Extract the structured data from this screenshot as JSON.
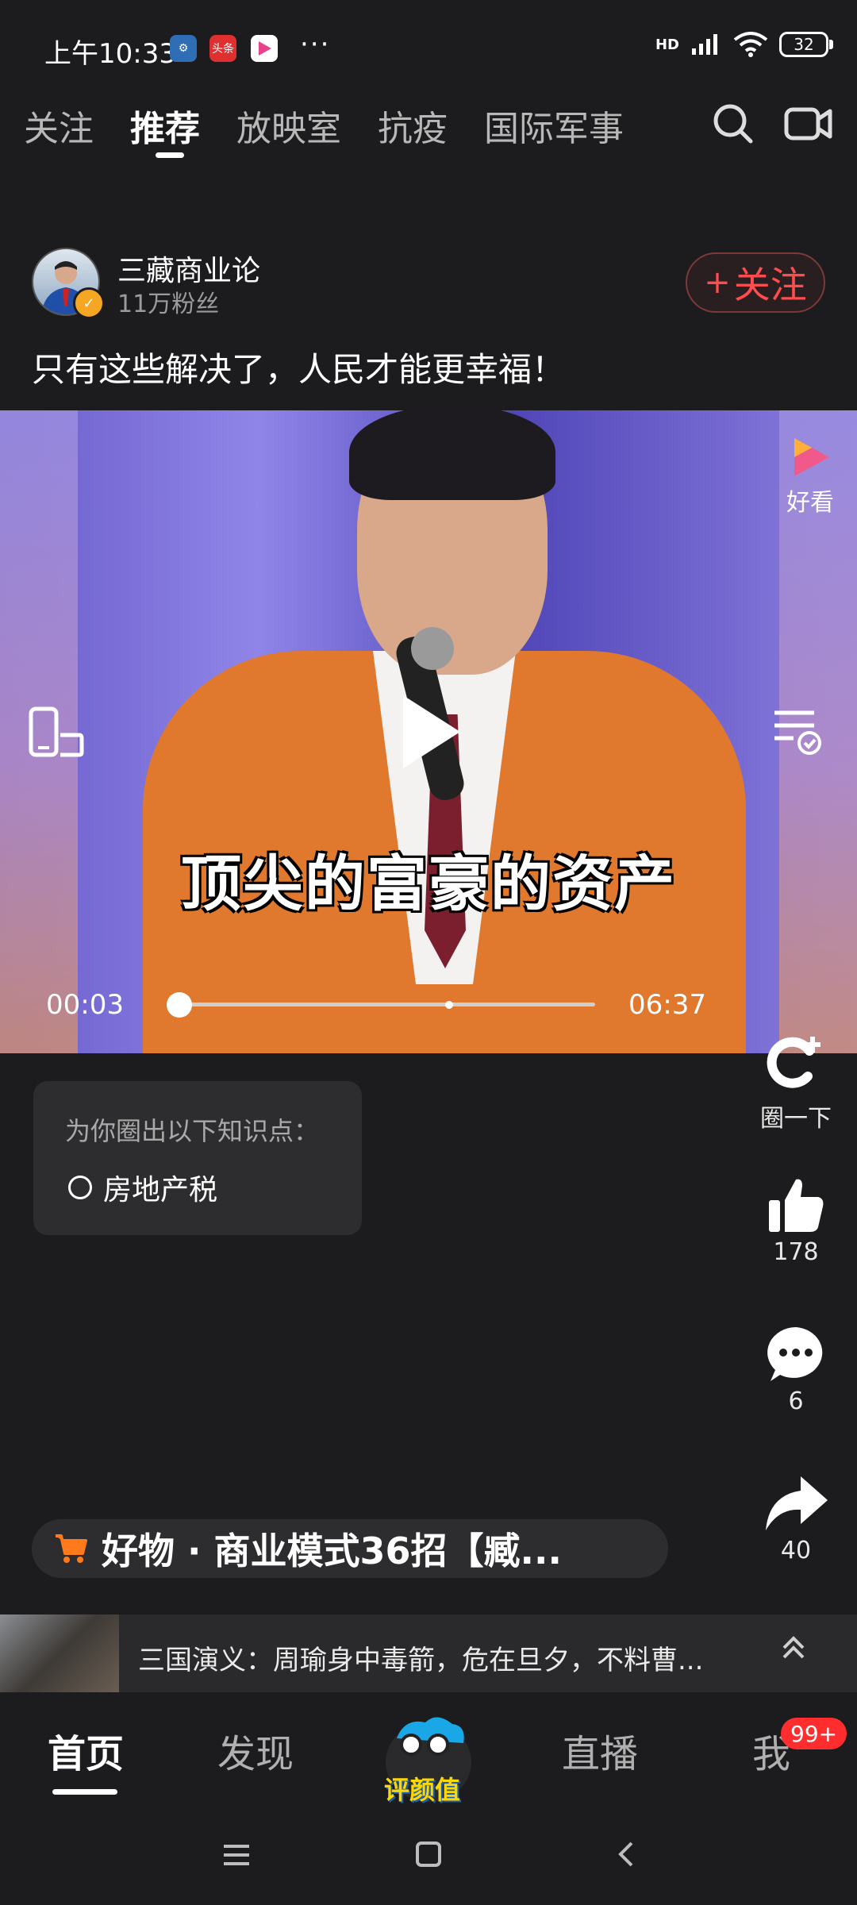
{
  "status_bar": {
    "time": "上午10:33",
    "app_badges": [
      "settings",
      "头条",
      "好看视频"
    ],
    "more": "···",
    "network": "HD",
    "battery": "32"
  },
  "top_tabs": [
    "关注",
    "推荐",
    "放映室",
    "抗疫",
    "国际军事"
  ],
  "active_tab": "推荐",
  "author": {
    "name": "三藏商业论",
    "fans": "11万粉丝",
    "follow_label": "关注",
    "follow_plus": "+"
  },
  "post_title": "只有这些解决了，人民才能更幸福！",
  "video": {
    "subtitle": "顶尖的富豪的资产",
    "current_time": "00:03",
    "total_time": "06:37",
    "progress": 0.0075,
    "watermark_label": "好看"
  },
  "actions": {
    "circle_label": "圈一下",
    "like_count": "178",
    "comment_count": "6",
    "share_count": "40"
  },
  "knowledge": {
    "title": "为你圈出以下知识点：",
    "items": [
      "房地产税"
    ]
  },
  "product": {
    "text": "好物 · 商业模式36招【臧..."
  },
  "next_video": {
    "title": "三国演义：周瑜身中毒箭，危在旦夕，不料曹..."
  },
  "bottom_nav": {
    "items": [
      "首页",
      "发现",
      "直播",
      "我"
    ],
    "center_label": "评颜值",
    "me_badge": "99+"
  },
  "colors": {
    "background": "#1c1c1e",
    "accent_red": "#ff4d4f",
    "cart_orange": "#ff7a1a",
    "badge_red": "#ff2d2d"
  }
}
